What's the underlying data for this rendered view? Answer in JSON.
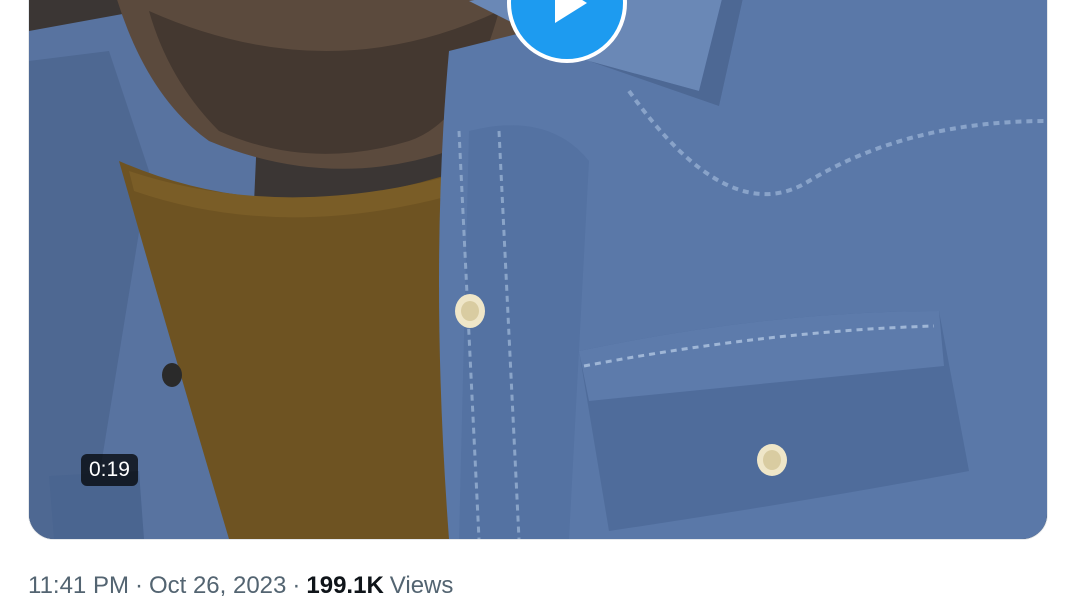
{
  "tweet": {
    "time": "11:41 PM",
    "separator": "·",
    "date": "Oct 26, 2023",
    "views_count": "199.1K",
    "views_label": "Views"
  },
  "video": {
    "duration": "0:19",
    "play_icon": "play-icon"
  },
  "colors": {
    "accent": "#1d9bf0",
    "meta_text": "#536471",
    "primary_text": "#0f1419"
  }
}
